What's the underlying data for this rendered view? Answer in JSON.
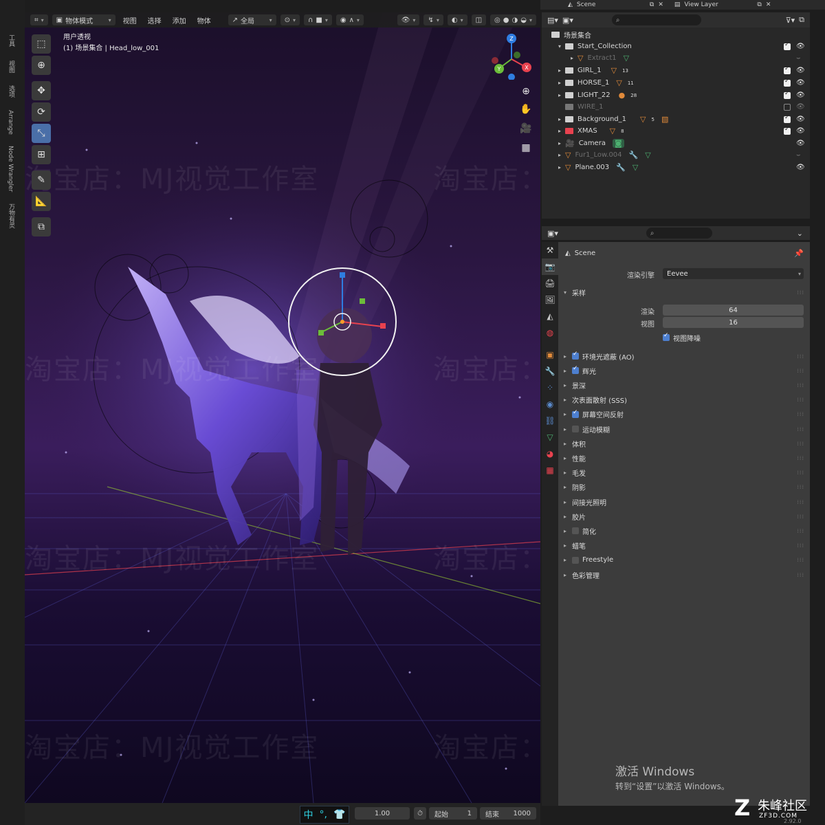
{
  "sidebar_tabs": [
    "工具",
    "视图",
    "选项",
    "Arrange",
    "Node Wrangler",
    "万物有灵"
  ],
  "viewport": {
    "mode_label": "物体模式",
    "menus": [
      "视图",
      "选择",
      "添加",
      "物体"
    ],
    "transform_orientation": "全局",
    "view_name": "用户透视",
    "object_path": "(1) 场景集合 | Head_low_001",
    "gizmo_axes": {
      "z": "Z",
      "y": "Y",
      "x": "X"
    },
    "watermark_text": "淘宝店：MJ视觉工作室",
    "colors": {
      "x_axis": "#e8424f",
      "y_axis": "#6cbd3a",
      "z_axis": "#2f7de1",
      "active_tool": "#4a6fa8"
    }
  },
  "top_bar": {
    "scene_label": "Scene",
    "view_layer_label": "View Layer"
  },
  "outliner": {
    "root": "场景集合",
    "rows": [
      {
        "name": "Start_Collection",
        "kind": "collection",
        "checked": true,
        "visible": true
      },
      {
        "name": "Extract1",
        "kind": "mesh",
        "dim": true
      },
      {
        "name": "GIRL_1",
        "kind": "collection",
        "badge": "13",
        "checked": true,
        "visible": true
      },
      {
        "name": "HORSE_1",
        "kind": "collection",
        "badge": "11",
        "checked": true,
        "visible": true
      },
      {
        "name": "LIGHT_22",
        "kind": "collection",
        "badge": "28",
        "checked": true,
        "visible": true
      },
      {
        "name": "WIRE_1",
        "kind": "collection",
        "dim": true,
        "checked": false,
        "visible": false
      },
      {
        "name": "Background_1",
        "kind": "collection",
        "badge": "5",
        "checked": true,
        "visible": true
      },
      {
        "name": "XMAS",
        "kind": "collection",
        "badge": "8",
        "checked": true,
        "visible": true
      },
      {
        "name": "Camera",
        "kind": "camera",
        "visible": true
      },
      {
        "name": "Fur1_Low.004",
        "kind": "mesh",
        "dim": true
      },
      {
        "name": "Plane.003",
        "kind": "mesh",
        "visible": true
      }
    ]
  },
  "properties": {
    "scene_name": "Scene",
    "render_engine_label": "渲染引擎",
    "render_engine_value": "Eevee",
    "sampling_label": "采样",
    "render_label": "渲染",
    "render_samples": "64",
    "viewport_label": "视图",
    "viewport_samples": "16",
    "viewport_denoise_label": "视图降噪",
    "panels": [
      {
        "label": "环境光遮蔽 (AO)",
        "checkbox": "on"
      },
      {
        "label": "辉光",
        "checkbox": "on"
      },
      {
        "label": "景深",
        "checkbox": "none"
      },
      {
        "label": "次表面散射 (SSS)",
        "checkbox": "none"
      },
      {
        "label": "屏幕空间反射",
        "checkbox": "on"
      },
      {
        "label": "运动模糊",
        "checkbox": "off"
      },
      {
        "label": "体积",
        "checkbox": "none"
      },
      {
        "label": "性能",
        "checkbox": "none"
      },
      {
        "label": "毛发",
        "checkbox": "none"
      },
      {
        "label": "阴影",
        "checkbox": "none"
      },
      {
        "label": "间接光照明",
        "checkbox": "none"
      },
      {
        "label": "胶片",
        "checkbox": "none"
      },
      {
        "label": "简化",
        "checkbox": "off"
      },
      {
        "label": "蜡笔",
        "checkbox": "none"
      },
      {
        "label": "Freestyle",
        "checkbox": "off"
      },
      {
        "label": "色彩管理",
        "checkbox": "none"
      }
    ]
  },
  "timeline": {
    "current_value": "1.00",
    "start_label": "起始",
    "start_value": "1",
    "end_label": "结束",
    "end_value": "1000"
  },
  "ime": {
    "lang": "中"
  },
  "overlay": {
    "activate_title": "激活 Windows",
    "activate_sub": "转到“设置”以激活 Windows。",
    "logo_name": "朱峰社区",
    "logo_url": "ZF3D.COM",
    "version": "2.92.0"
  }
}
